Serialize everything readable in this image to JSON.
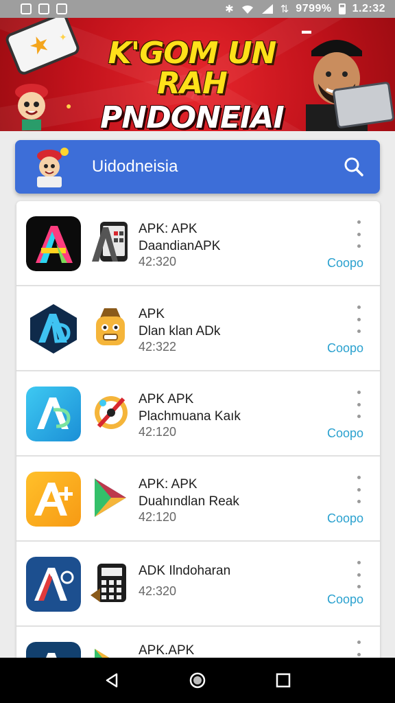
{
  "status_bar": {
    "left_icons": [
      "notification-icon",
      "notification-icon",
      "image-icon"
    ],
    "battery_text": "9799%",
    "time": "1.2:32"
  },
  "banner": {
    "line1": "K'GOM UN RAH",
    "line2": "PNDONEIAI",
    "colors": {
      "background": "#c1121b",
      "title1": "#ffe11a",
      "title2": "#ffffff"
    }
  },
  "search": {
    "text": "Uidodneisia",
    "icon": "search-icon",
    "color": "#3d6ed8"
  },
  "apps": [
    {
      "title": "APK: APK\nDaandianAPK",
      "time": "42:320",
      "action": "Coopo",
      "icon": "app-a-icon",
      "sub_icon": "device-icon"
    },
    {
      "title": "APK\nDlan klan ADk",
      "time": "42:322",
      "action": "Coopo",
      "icon": "app-ad-icon",
      "sub_icon": "mascot-icon"
    },
    {
      "title": "APK APK\nPlachmuana Kaık",
      "time": "42:120",
      "action": "Coopo",
      "icon": "app-ad-icon",
      "sub_icon": "compass-icon"
    },
    {
      "title": "APK: APK\nDuahındlan Reak",
      "time": "42:120",
      "action": "Coopo",
      "icon": "app-a-plus-icon",
      "sub_icon": "play-icon"
    },
    {
      "title": "ADK Ilndoharan",
      "time": "42:320",
      "action": "Coopo",
      "icon": "app-a-icon",
      "sub_icon": "calculator-icon"
    },
    {
      "title": "APK.APK",
      "time": "",
      "action": "",
      "icon": "app-a-icon",
      "sub_icon": "play-icon"
    }
  ],
  "nav": {
    "back": "back-icon",
    "home": "home-icon",
    "recents": "recents-icon"
  },
  "colors": {
    "accent": "#2aa1cf",
    "status_bar": "#9e9e9e"
  }
}
